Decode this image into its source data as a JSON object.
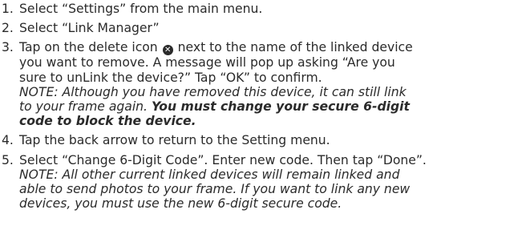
{
  "steps": [
    {
      "number": "1.",
      "text": "Select “Settings” from the main menu."
    },
    {
      "number": "2.",
      "text": "Select “Link Manager”"
    },
    {
      "number": "3.",
      "line1_a": "Tap on the delete icon",
      "delete_icon_glyph": "✕",
      "line1_b": "next to the name of the linked device",
      "line2": "you want to remove. A message will pop up asking “Are you",
      "line3": "sure to unLink the device?” Tap “OK” to confirm.",
      "note_line1": "NOTE: Although you have removed this device, it can still link",
      "note_line2_a": "to your frame again.",
      "note_line2_b": "You must change your secure 6-digit",
      "note_line3": "code to block the device."
    },
    {
      "number": "4.",
      "text": "Tap the back arrow to return to the Setting menu."
    },
    {
      "number": "5.",
      "line1": "Select “Change 6-Digit Code”. Enter new code. Then tap “Done”.",
      "note_line1": "NOTE: All other current linked devices will remain linked and",
      "note_line2": "able to send photos to your frame. If you want to link any new",
      "note_line3": "devices, you must use the new 6-digit secure code."
    }
  ],
  "icons": {
    "delete": "delete-icon"
  },
  "colors": {
    "text": "#2b2b2b",
    "background": "#ffffff"
  }
}
